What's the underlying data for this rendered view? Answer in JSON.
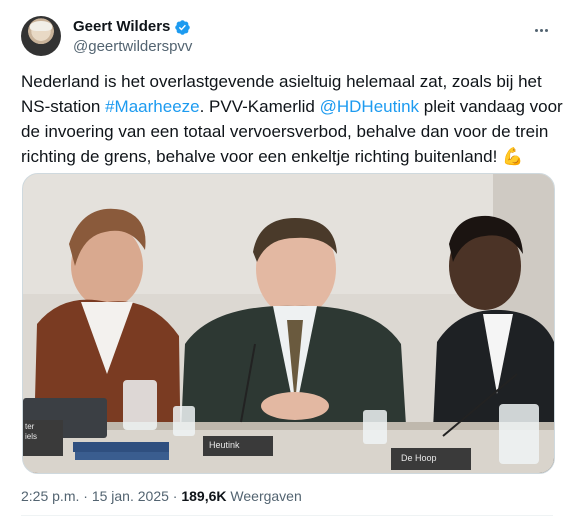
{
  "author": {
    "display_name": "Geert Wilders",
    "handle": "@geertwilderspvv",
    "verified": true
  },
  "tweet": {
    "line1": "Nederland is het overlastgevende asieltuig  helemaal zat, zoals bij het",
    "line2_prefix": "NS-station ",
    "hashtag": "#Maarheeze",
    "line2_middle": ". PVV-Kamerlid ",
    "mention": "@HDHeutink",
    "line2_suffix": " pleit vandaag voor",
    "line3": "de invoering van een totaal vervoersverbod, behalve dan voor de trein",
    "line4": "richting de grens, behalve voor een enkeltje richting buitenland!",
    "emoji": "💪"
  },
  "media": {
    "name_cards": [
      "Heutink",
      "De Hoop"
    ],
    "left_card_text": "ter\niels"
  },
  "meta": {
    "time": "2:25 p.m.",
    "separator": "·",
    "date": "15 jan. 2025",
    "views_count": "189,6K",
    "views_label": "Weergaven"
  },
  "icons": {
    "more": "more-horizontal-icon",
    "verified": "verified-badge-icon"
  },
  "colors": {
    "link": "#1d9bf0",
    "muted": "#536471",
    "text": "#0f1419"
  }
}
